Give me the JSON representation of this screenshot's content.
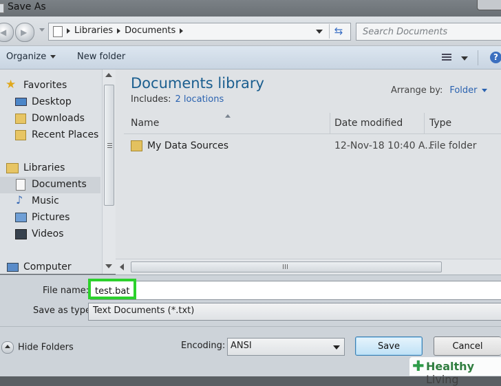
{
  "window": {
    "title": "Save As"
  },
  "address_bar": {
    "crumbs": [
      "Libraries",
      "Documents"
    ],
    "search_placeholder": "Search Documents"
  },
  "toolbar": {
    "organize": "Organize",
    "new_folder": "New folder"
  },
  "nav": {
    "favorites": "Favorites",
    "desktop": "Desktop",
    "downloads": "Downloads",
    "recent_places": "Recent Places",
    "libraries": "Libraries",
    "documents": "Documents",
    "music": "Music",
    "pictures": "Pictures",
    "videos": "Videos",
    "computer": "Computer"
  },
  "content": {
    "library_title": "Documents library",
    "includes_label": "Includes:",
    "includes_link": "2 locations",
    "arrange_label": "Arrange by:",
    "arrange_value": "Folder",
    "columns": {
      "name": "Name",
      "date": "Date modified",
      "type": "Type"
    },
    "rows": [
      {
        "name": "My Data Sources",
        "date": "12-Nov-18 10:40 A...",
        "type": "File folder"
      }
    ]
  },
  "form": {
    "file_name_label": "File name:",
    "file_name_value": "test.bat",
    "save_type_label": "Save as type:",
    "save_type_value": "Text Documents (*.txt)",
    "hide_folders": "Hide Folders",
    "encoding_label": "Encoding:",
    "encoding_value": "ANSI",
    "save_button": "Save",
    "cancel_button": "Cancel"
  },
  "watermark": {
    "brand_bold": "Healthy",
    "brand_rest": " Living"
  },
  "colors": {
    "highlight": "#2cd12c",
    "accent": "#2a62b0",
    "title": "#1a5e8f"
  }
}
